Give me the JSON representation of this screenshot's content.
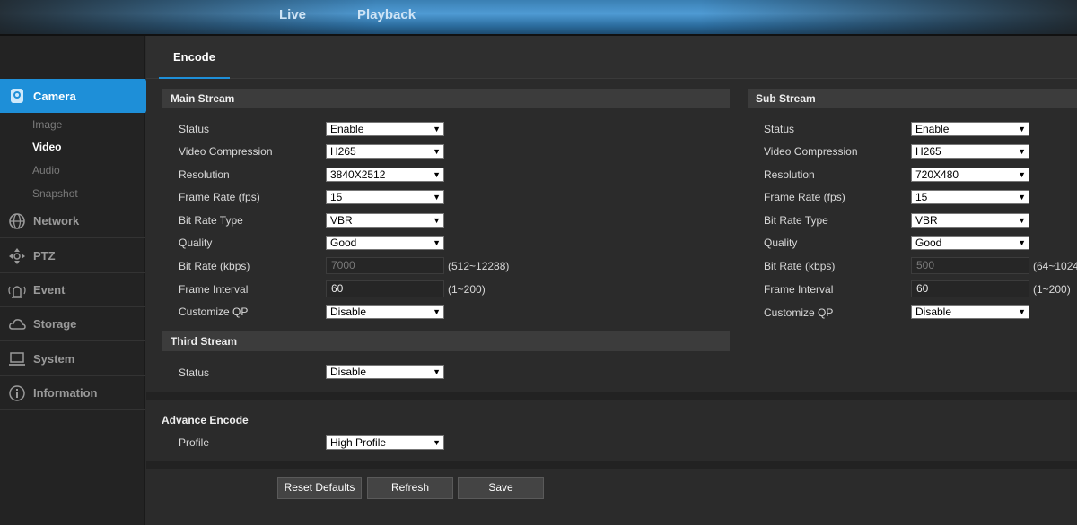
{
  "topnav": {
    "live": "Live",
    "playback": "Playback"
  },
  "sidebar": {
    "camera": "Camera",
    "sub_items": [
      "Image",
      "Video",
      "Audio",
      "Snapshot"
    ],
    "network": "Network",
    "ptz": "PTZ",
    "event": "Event",
    "storage": "Storage",
    "system": "System",
    "information": "Information"
  },
  "tab": {
    "encode": "Encode"
  },
  "main_stream": {
    "title": "Main Stream",
    "labels": {
      "status": "Status",
      "video_compression": "Video Compression",
      "resolution": "Resolution",
      "frame_rate": "Frame Rate (fps)",
      "bit_rate_type": "Bit Rate Type",
      "quality": "Quality",
      "bit_rate": "Bit Rate (kbps)",
      "frame_interval": "Frame Interval",
      "customize_qp": "Customize QP"
    },
    "values": {
      "status": "Enable",
      "video_compression": "H265",
      "resolution": "3840X2512",
      "frame_rate": "15",
      "bit_rate_type": "VBR",
      "quality": "Good",
      "bit_rate": "7000",
      "frame_interval": "60",
      "customize_qp": "Disable"
    },
    "bit_rate_hint": "(512~12288)",
    "frame_interval_hint": "(1~200)"
  },
  "sub_stream": {
    "title": "Sub Stream",
    "labels": {
      "status": "Status",
      "video_compression": "Video Compression",
      "resolution": "Resolution",
      "frame_rate": "Frame Rate (fps)",
      "bit_rate_type": "Bit Rate Type",
      "quality": "Quality",
      "bit_rate": "Bit Rate (kbps)",
      "frame_interval": "Frame Interval",
      "customize_qp": "Customize QP"
    },
    "values": {
      "status": "Enable",
      "video_compression": "H265",
      "resolution": "720X480",
      "frame_rate": "15",
      "bit_rate_type": "VBR",
      "quality": "Good",
      "bit_rate": "500",
      "frame_interval": "60",
      "customize_qp": "Disable"
    },
    "bit_rate_hint": "(64~1024",
    "frame_interval_hint": "(1~200)"
  },
  "third_stream": {
    "title": "Third Stream",
    "status_label": "Status",
    "status_value": "Disable"
  },
  "advance_encode": {
    "title": "Advance Encode",
    "profile_label": "Profile",
    "profile_value": "High Profile"
  },
  "buttons": {
    "reset_defaults": "Reset Defaults",
    "refresh": "Refresh",
    "save": "Save"
  },
  "colors": {
    "accent": "#1e8fd8",
    "panel": "#2b2b2b",
    "section_header": "#3c3c3c"
  }
}
